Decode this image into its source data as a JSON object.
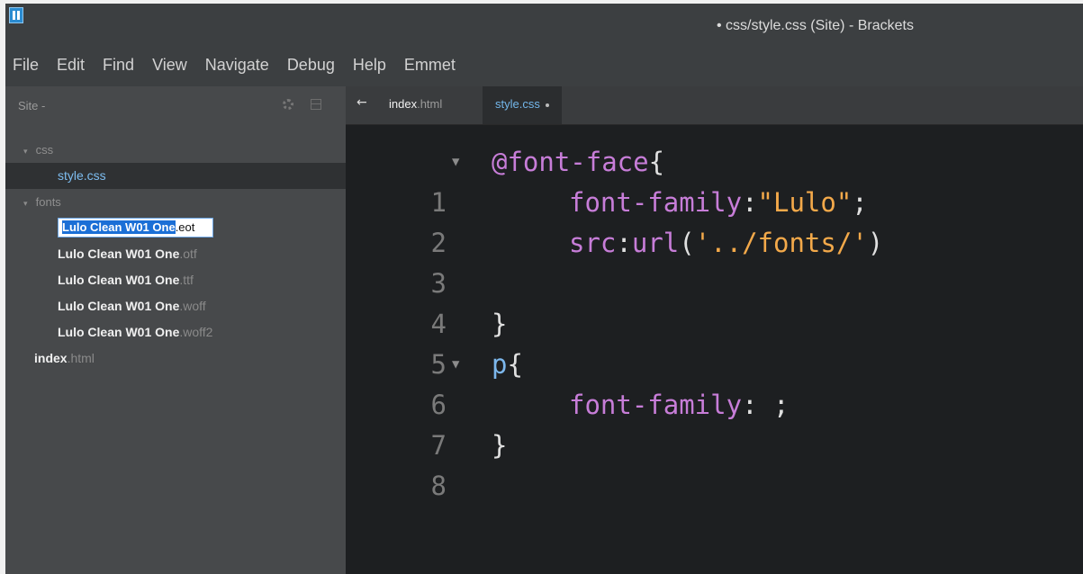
{
  "window": {
    "title": "• css/style.css (Site) - Brackets"
  },
  "menu": [
    "File",
    "Edit",
    "Find",
    "View",
    "Navigate",
    "Debug",
    "Help",
    "Emmet"
  ],
  "sidebar": {
    "project": "Site -",
    "tree": [
      {
        "kind": "folder",
        "label": "css"
      },
      {
        "kind": "file",
        "base": "style.css",
        "ext": ""
      },
      {
        "kind": "folder",
        "label": "fonts"
      },
      {
        "kind": "file",
        "base": "Lulo Clean W01 One",
        "ext": ".eot"
      },
      {
        "kind": "file",
        "base": "Lulo Clean W01 One",
        "ext": ".otf"
      },
      {
        "kind": "file",
        "base": "Lulo Clean W01 One",
        "ext": ".ttf"
      },
      {
        "kind": "file",
        "base": "Lulo Clean W01 One",
        "ext": ".woff"
      },
      {
        "kind": "file",
        "base": "Lulo Clean W01 One",
        "ext": ".woff2"
      },
      {
        "kind": "file",
        "base": "index",
        "ext": ".html"
      }
    ]
  },
  "tabs": {
    "back_glyph": "←",
    "index_base": "index",
    "index_ext": ".html",
    "style_label": "style.css"
  },
  "code": {
    "line_numbers": [
      "1",
      "2",
      "3",
      "4",
      "5",
      "6",
      "7",
      "8"
    ],
    "l1": {
      "kw": "@font-face",
      "p": "{"
    },
    "l2": {
      "prop": "font-family",
      "colon": ":",
      "str": "\"Lulo\"",
      "semi": ";"
    },
    "l3": {
      "prop": "src",
      "colon": ":",
      "fn": "url",
      "open": "(",
      "str": "'../fonts/'",
      "close": ")"
    },
    "l5": {
      "p": "}"
    },
    "l6": {
      "sel": "p",
      "p": "{"
    },
    "l7": {
      "prop": "font-family",
      "rest": ": ;"
    },
    "l8": {
      "p": "}"
    }
  },
  "colors": {
    "keyword": "#c77dd8",
    "string": "#f3a94a",
    "selection": "#1b6fd6",
    "active_tab": "#73b6ea"
  }
}
